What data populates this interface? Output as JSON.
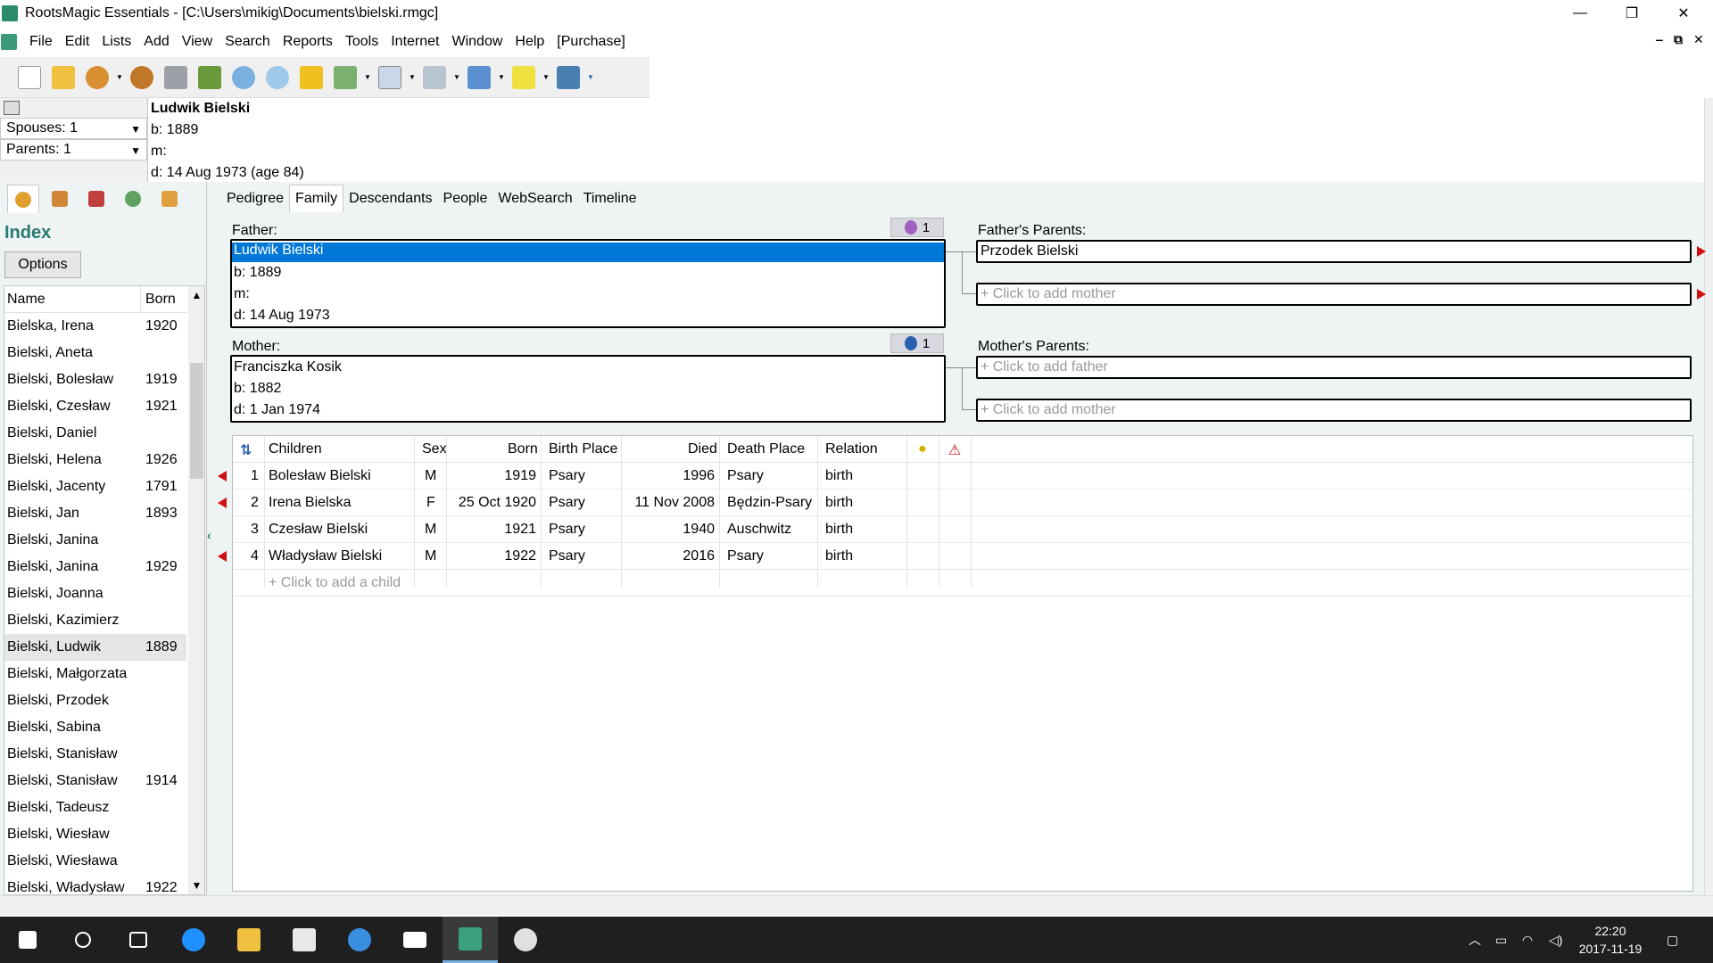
{
  "window": {
    "title": "RootsMagic Essentials - [C:\\Users\\mikig\\Documents\\bielski.rmgc]",
    "minimize": "—",
    "maximize": "❐",
    "close": "✕"
  },
  "menu": {
    "items": [
      "File",
      "Edit",
      "Lists",
      "Add",
      "View",
      "Search",
      "Reports",
      "Tools",
      "Internet",
      "Window",
      "Help",
      "[Purchase]"
    ],
    "mdi_min": "‒",
    "mdi_restore": "⧉",
    "mdi_close": "✕"
  },
  "selectors": {
    "spouses": "Spouses: 1",
    "parents": "Parents: 1"
  },
  "person": {
    "name": "Ludwik Bielski",
    "born": "b: 1889",
    "married": "m:",
    "died": "d: 14 Aug 1973 (age 84)"
  },
  "sidebar": {
    "title": "Index",
    "options_label": "Options",
    "col_name": "Name",
    "col_born": "Born",
    "rows": [
      {
        "name": "Bielska, Irena",
        "born": "1920"
      },
      {
        "name": "Bielski, Aneta",
        "born": ""
      },
      {
        "name": "Bielski, Bolesław",
        "born": "1919"
      },
      {
        "name": "Bielski, Czesław",
        "born": "1921"
      },
      {
        "name": "Bielski, Daniel",
        "born": ""
      },
      {
        "name": "Bielski, Helena",
        "born": "1926"
      },
      {
        "name": "Bielski, Jacenty",
        "born": "1791"
      },
      {
        "name": "Bielski, Jan",
        "born": "1893"
      },
      {
        "name": "Bielski, Janina",
        "born": ""
      },
      {
        "name": "Bielski, Janina",
        "born": "1929"
      },
      {
        "name": "Bielski, Joanna",
        "born": ""
      },
      {
        "name": "Bielski, Kazimierz",
        "born": ""
      },
      {
        "name": "Bielski, Ludwik",
        "born": "1889"
      },
      {
        "name": "Bielski, Małgorzata",
        "born": ""
      },
      {
        "name": "Bielski, Przodek",
        "born": ""
      },
      {
        "name": "Bielski, Sabina",
        "born": ""
      },
      {
        "name": "Bielski, Stanisław",
        "born": ""
      },
      {
        "name": "Bielski, Stanisław",
        "born": "1914"
      },
      {
        "name": "Bielski, Tadeusz",
        "born": ""
      },
      {
        "name": "Bielski, Wiesław",
        "born": ""
      },
      {
        "name": "Bielski, Wiesława",
        "born": ""
      },
      {
        "name": "Bielski, Władysław",
        "born": "1922"
      }
    ]
  },
  "view_tabs": [
    "Pedigree",
    "Family",
    "Descendants",
    "People",
    "WebSearch",
    "Timeline"
  ],
  "family": {
    "father_label": "Father:",
    "father_badge": "1",
    "father": {
      "name": "Ludwik Bielski",
      "born": "b: 1889",
      "married": "m:",
      "died": "d: 14 Aug 1973"
    },
    "mother_label": "Mother:",
    "mother_badge": "1",
    "mother": {
      "name": "Franciszka Kosik",
      "born": "b: 1882",
      "died": "d: 1 Jan 1974"
    },
    "fathers_parents_label": "Father's Parents:",
    "fathers_father": "Przodek Bielski",
    "fathers_mother": "+ Click to add mother",
    "mothers_parents_label": "Mother's Parents:",
    "mothers_father": "+ Click to add father",
    "mothers_mother": "+ Click to add mother"
  },
  "children": {
    "headers": {
      "children": "Children",
      "sex": "Sex",
      "born": "Born",
      "birth_place": "Birth Place",
      "died": "Died",
      "death_place": "Death Place",
      "relation": "Relation"
    },
    "rows": [
      {
        "num": "1",
        "name": "Bolesław Bielski",
        "sex": "M",
        "born": "1919",
        "birth_place": "Psary",
        "died": "1996",
        "death_place": "Psary",
        "relation": "birth",
        "has_arrow": true
      },
      {
        "num": "2",
        "name": "Irena Bielska",
        "sex": "F",
        "born": "25 Oct 1920",
        "birth_place": "Psary",
        "died": "11 Nov 2008",
        "death_place": "Będzin-Psary",
        "relation": "birth",
        "has_arrow": true
      },
      {
        "num": "3",
        "name": "Czesław Bielski",
        "sex": "M",
        "born": "1921",
        "birth_place": "Psary",
        "died": "1940",
        "death_place": "Auschwitz",
        "relation": "birth",
        "has_arrow": false
      },
      {
        "num": "4",
        "name": "Władysław Bielski",
        "sex": "M",
        "born": "1922",
        "birth_place": "Psary",
        "died": "2016",
        "death_place": "Psary",
        "relation": "birth",
        "has_arrow": true
      }
    ],
    "add_child": "+ Click to add a child"
  },
  "taskbar": {
    "time": "22:20",
    "date": "2017-11-19"
  },
  "colors": {
    "accent": "#0078d7",
    "index_title": "#2a7a70",
    "sidebar_bg": "#eef3f3",
    "taskbar_bg": "#1f1f1f",
    "red_marker": "#d01010"
  }
}
